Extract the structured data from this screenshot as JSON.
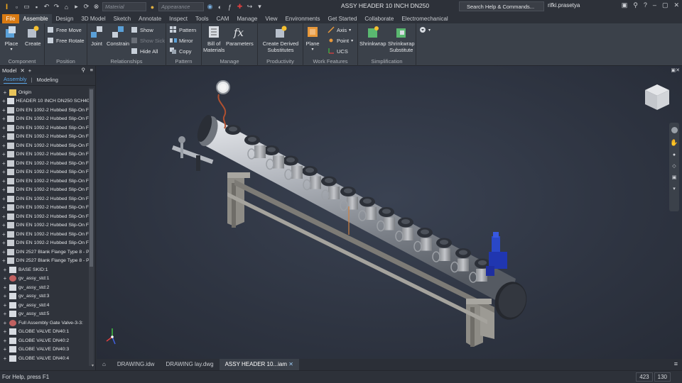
{
  "app": {
    "window_title": "ASSY HEADER 10 INCH DN250",
    "search_placeholder": "Search Help & Commands...",
    "username": "rifki.prasetya",
    "material_placeholder": "Material",
    "appearance_placeholder": "Appearance"
  },
  "tabs": [
    "File",
    "Assemble",
    "Design",
    "3D Model",
    "Sketch",
    "Annotate",
    "Inspect",
    "Tools",
    "CAM",
    "Manage",
    "View",
    "Environments",
    "Get Started",
    "Collaborate",
    "Electromechanical"
  ],
  "active_tab": "Assemble",
  "ribbon": {
    "component": {
      "label": "Component",
      "place": "Place",
      "create": "Create"
    },
    "position": {
      "label": "Position",
      "free_move": "Free Move",
      "free_rotate": "Free Rotate"
    },
    "relationships": {
      "label": "Relationships",
      "joint": "Joint",
      "constrain": "Constrain",
      "show": "Show",
      "show_sick": "Show Sick",
      "hide_all": "Hide All"
    },
    "pattern": {
      "label": "Pattern",
      "pattern": "Pattern",
      "mirror": "Mirror",
      "copy": "Copy"
    },
    "manage": {
      "label": "Manage",
      "bom": "Bill of\nMaterials",
      "parameters": "Parameters"
    },
    "productivity": {
      "label": "Productivity",
      "create_derived": "Create Derived\nSubstitutes"
    },
    "work_features": {
      "label": "Work Features",
      "plane": "Plane",
      "axis": "Axis",
      "point": "Point",
      "ucs": "UCS"
    },
    "simplification": {
      "label": "Simplification",
      "shrinkwrap": "Shrinkwrap",
      "shrinkwrap_sub": "Shrinkwrap\nSubstitute"
    }
  },
  "browser": {
    "title": "Model",
    "tab_assembly": "Assembly",
    "tab_modeling": "Modeling",
    "items": [
      {
        "label": "Origin",
        "type": "folder"
      },
      {
        "label": "HEADER 10 INCH DN250 SCH40:1",
        "type": "part"
      },
      {
        "label": "DIN EN 1092-2 Hubbed Slip-On Fla",
        "type": "flange"
      },
      {
        "label": "DIN EN 1092-2 Hubbed Slip-On Fla",
        "type": "flange"
      },
      {
        "label": "DIN EN 1092-2 Hubbed Slip-On Fla",
        "type": "flange"
      },
      {
        "label": "DIN EN 1092-2 Hubbed Slip-On Fla",
        "type": "flange"
      },
      {
        "label": "DIN EN 1092-2 Hubbed Slip-On Fla",
        "type": "flange"
      },
      {
        "label": "DIN EN 1092-2 Hubbed Slip-On Fla",
        "type": "flange"
      },
      {
        "label": "DIN EN 1092-2 Hubbed Slip-On Fla",
        "type": "flange"
      },
      {
        "label": "DIN EN 1092-2 Hubbed Slip-On Fla",
        "type": "flange"
      },
      {
        "label": "DIN EN 1092-2 Hubbed Slip-On Fla",
        "type": "flange"
      },
      {
        "label": "DIN EN 1092-2 Hubbed Slip-On Fla",
        "type": "flange"
      },
      {
        "label": "DIN EN 1092-2 Hubbed Slip-On Fla",
        "type": "flange"
      },
      {
        "label": "DIN EN 1092-2 Hubbed Slip-On Fla",
        "type": "flange"
      },
      {
        "label": "DIN EN 1092-2 Hubbed Slip-On Fla",
        "type": "flange"
      },
      {
        "label": "DIN EN 1092-2 Hubbed Slip-On Fla",
        "type": "flange"
      },
      {
        "label": "DIN EN 1092-2 Hubbed Slip-On Fla",
        "type": "flange"
      },
      {
        "label": "DIN EN 1092-2 Hubbed Slip-On Fla",
        "type": "flange"
      },
      {
        "label": "DIN 2527 Blank Flange Type 8 - Pl",
        "type": "flange"
      },
      {
        "label": "DIN 2527 Blank Flange Type 8 - Pl",
        "type": "flange"
      },
      {
        "label": "BASE SKID:1",
        "type": "part"
      },
      {
        "label": "gv_assy_std:1",
        "type": "assy"
      },
      {
        "label": "gv_assy_std:2",
        "type": "part"
      },
      {
        "label": "gv_assy_std:3",
        "type": "part"
      },
      {
        "label": "gv_assy_std:4",
        "type": "part"
      },
      {
        "label": "gv_assy_std:5",
        "type": "part"
      },
      {
        "label": "Full Assembly Gate Valve-3-3:",
        "type": "assy"
      },
      {
        "label": "GLOBE VALVE DN40:1",
        "type": "part"
      },
      {
        "label": "GLOBE VALVE DN40:2",
        "type": "part"
      },
      {
        "label": "GLOBE VALVE DN40:3",
        "type": "part"
      },
      {
        "label": "GLOBE VALVE DN40:4",
        "type": "part"
      }
    ]
  },
  "doc_tabs": [
    "DRAWING.idw",
    "DRAWING lay.dwg",
    "ASSY HEADER 10...iam"
  ],
  "active_doc": "ASSY HEADER 10...iam",
  "status": {
    "help": "For Help, press F1",
    "count1": "423",
    "count2": "130"
  }
}
